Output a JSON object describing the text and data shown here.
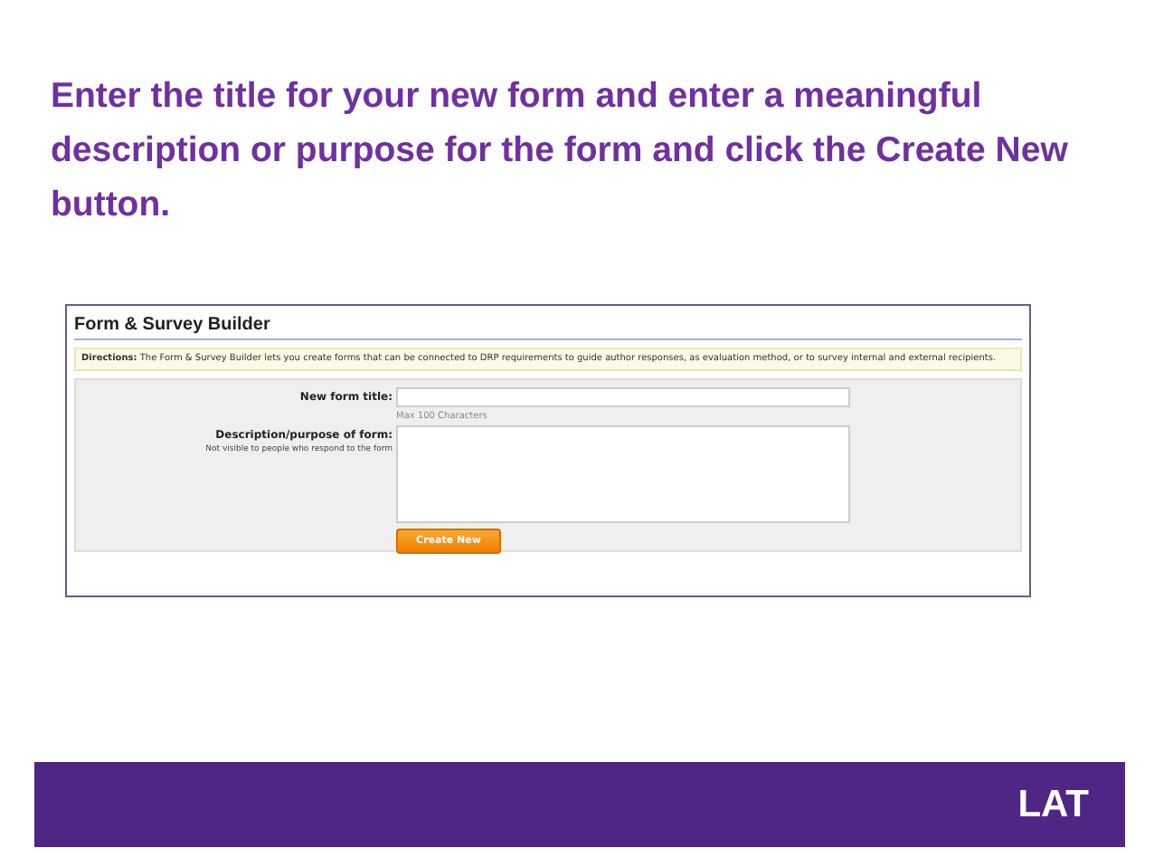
{
  "slide": {
    "heading": "Enter the title for your new form and enter a meaningful description or purpose for the form and click the Create New button.",
    "footer_logo": "LAT"
  },
  "screenshot": {
    "title": "Form & Survey Builder",
    "directions": "**Directions:** The Form & Survey Builder lets you create forms that can be connected to DRP requirements to guide author responses, as evaluation method, or to survey internal and external recipients.",
    "fields": [
      {
        "kind": "text",
        "label": "New form title:",
        "hint": "Max 100 Characters"
      },
      {
        "kind": "textarea",
        "label": "Description/purpose of form:",
        "note": "Not visible to people who respond to the form"
      }
    ],
    "button": "Create New"
  }
}
